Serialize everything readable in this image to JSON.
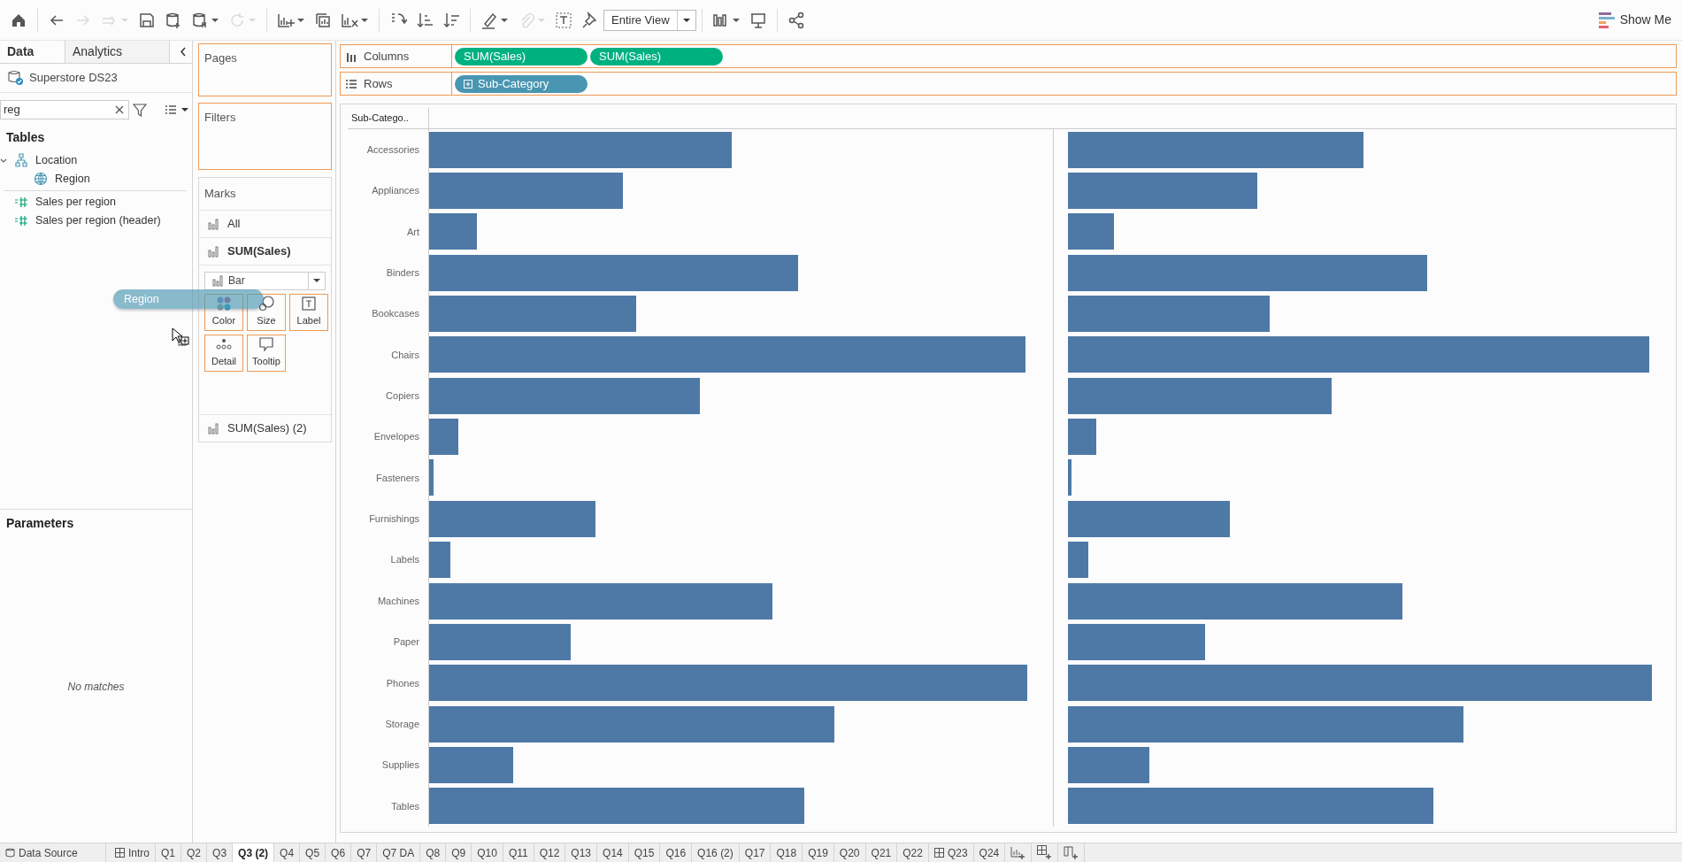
{
  "toolbar": {
    "buttons": [
      {
        "kind": "home",
        "disabled": false
      },
      {
        "kind": "back",
        "disabled": false
      },
      {
        "kind": "forward",
        "disabled": true
      },
      {
        "kind": "redo",
        "disabled": true
      },
      {
        "kind": "save",
        "disabled": false
      },
      {
        "kind": "datasource",
        "disabled": false
      },
      {
        "kind": "pause",
        "disabled": false
      },
      {
        "kind": "refresh",
        "disabled": true
      },
      {
        "kind": "newsheet",
        "disabled": false
      },
      {
        "kind": "duplicate",
        "disabled": false
      },
      {
        "kind": "clear",
        "disabled": false
      },
      {
        "kind": "swap",
        "disabled": false
      },
      {
        "kind": "sortasc",
        "disabled": false
      },
      {
        "kind": "sortdesc",
        "disabled": false
      },
      {
        "kind": "highlight",
        "disabled": false
      },
      {
        "kind": "attach",
        "disabled": true
      },
      {
        "kind": "labels",
        "disabled": false
      },
      {
        "kind": "pin",
        "disabled": false
      },
      {
        "kind": "fit"
      },
      {
        "kind": "chart",
        "disabled": false
      },
      {
        "kind": "present",
        "disabled": false
      },
      {
        "kind": "share",
        "disabled": false
      }
    ],
    "fit_value": "Entire View",
    "show_me": "Show Me"
  },
  "side_tabs": [
    {
      "label": "Data",
      "selected": true
    },
    {
      "label": "Analytics",
      "selected": false
    }
  ],
  "data_source": "Superstore DS23",
  "search": {
    "value": "reg"
  },
  "tables": {
    "heading": "Tables",
    "items": [
      {
        "label": "Location",
        "kind": "hierarchy",
        "expanded": true,
        "children": [
          {
            "label": "Region",
            "kind": "geo"
          }
        ]
      },
      {
        "label": "Sales per region",
        "kind": "measure"
      },
      {
        "label": "Sales per region (header)",
        "kind": "measure"
      }
    ]
  },
  "parameters": {
    "heading": "Parameters",
    "message": "No matches"
  },
  "pages_shelf": {
    "label": "Pages"
  },
  "filters_shelf": {
    "label": "Filters"
  },
  "marks": {
    "title": "Marks",
    "cards": [
      {
        "label": "All",
        "selected": false
      },
      {
        "label": "SUM(Sales)",
        "selected": true
      }
    ],
    "mark_type": "Bar",
    "buttons": [
      {
        "label": "Color",
        "kind": "color"
      },
      {
        "label": "Size",
        "kind": "size"
      },
      {
        "label": "Label",
        "kind": "label"
      },
      {
        "label": "Detail",
        "kind": "detail"
      },
      {
        "label": "Tooltip",
        "kind": "tooltip"
      }
    ],
    "second_card": {
      "label": "SUM(Sales) (2)",
      "selected": false
    }
  },
  "drag_pill": "Region",
  "columns_shelf": {
    "label": "Columns",
    "pills": [
      {
        "label": "SUM(Sales)",
        "kind": "measure"
      },
      {
        "label": "SUM(Sales)",
        "kind": "measure"
      }
    ]
  },
  "rows_shelf": {
    "label": "Rows",
    "pills": [
      {
        "label": "Sub-Category",
        "kind": "dimension"
      }
    ]
  },
  "view": {
    "header": "Sub-Catego..",
    "rows": [
      "Accessories",
      "Appliances",
      "Art",
      "Binders",
      "Bookcases",
      "Chairs",
      "Copiers",
      "Envelopes",
      "Fasteners",
      "Furnishings",
      "Labels",
      "Machines",
      "Paper",
      "Phones",
      "Storage",
      "Supplies",
      "Tables"
    ]
  },
  "sheet_tabs": [
    {
      "label": "Data Source",
      "kind": "datasource",
      "selected": false
    },
    {
      "label": "Intro",
      "kind": "dashboard",
      "selected": false
    },
    {
      "label": "Q1",
      "kind": "sheet",
      "selected": false
    },
    {
      "label": "Q2",
      "kind": "sheet",
      "selected": false
    },
    {
      "label": "Q3",
      "kind": "sheet",
      "selected": false
    },
    {
      "label": "Q3 (2)",
      "kind": "sheet",
      "selected": true
    },
    {
      "label": "Q4",
      "kind": "sheet",
      "selected": false
    },
    {
      "label": "Q5",
      "kind": "sheet",
      "selected": false
    },
    {
      "label": "Q6",
      "kind": "sheet",
      "selected": false
    },
    {
      "label": "Q7",
      "kind": "sheet",
      "selected": false
    },
    {
      "label": "Q7 DA",
      "kind": "sheet",
      "selected": false
    },
    {
      "label": "Q8",
      "kind": "sheet",
      "selected": false
    },
    {
      "label": "Q9",
      "kind": "sheet",
      "selected": false
    },
    {
      "label": "Q10",
      "kind": "sheet",
      "selected": false
    },
    {
      "label": "Q11",
      "kind": "sheet",
      "selected": false
    },
    {
      "label": "Q12",
      "kind": "sheet",
      "selected": false
    },
    {
      "label": "Q13",
      "kind": "sheet",
      "selected": false
    },
    {
      "label": "Q14",
      "kind": "sheet",
      "selected": false
    },
    {
      "label": "Q15",
      "kind": "sheet",
      "selected": false
    },
    {
      "label": "Q16",
      "kind": "sheet",
      "selected": false
    },
    {
      "label": "Q16 (2)",
      "kind": "sheet",
      "selected": false
    },
    {
      "label": "Q17",
      "kind": "sheet",
      "selected": false
    },
    {
      "label": "Q18",
      "kind": "sheet",
      "selected": false
    },
    {
      "label": "Q19",
      "kind": "sheet",
      "selected": false
    },
    {
      "label": "Q20",
      "kind": "sheet",
      "selected": false
    },
    {
      "label": "Q21",
      "kind": "sheet",
      "selected": false
    },
    {
      "label": "Q22",
      "kind": "sheet",
      "selected": false
    },
    {
      "label": "Q23",
      "kind": "dashboard",
      "selected": false
    },
    {
      "label": "Q24",
      "kind": "sheet",
      "selected": false
    }
  ]
}
